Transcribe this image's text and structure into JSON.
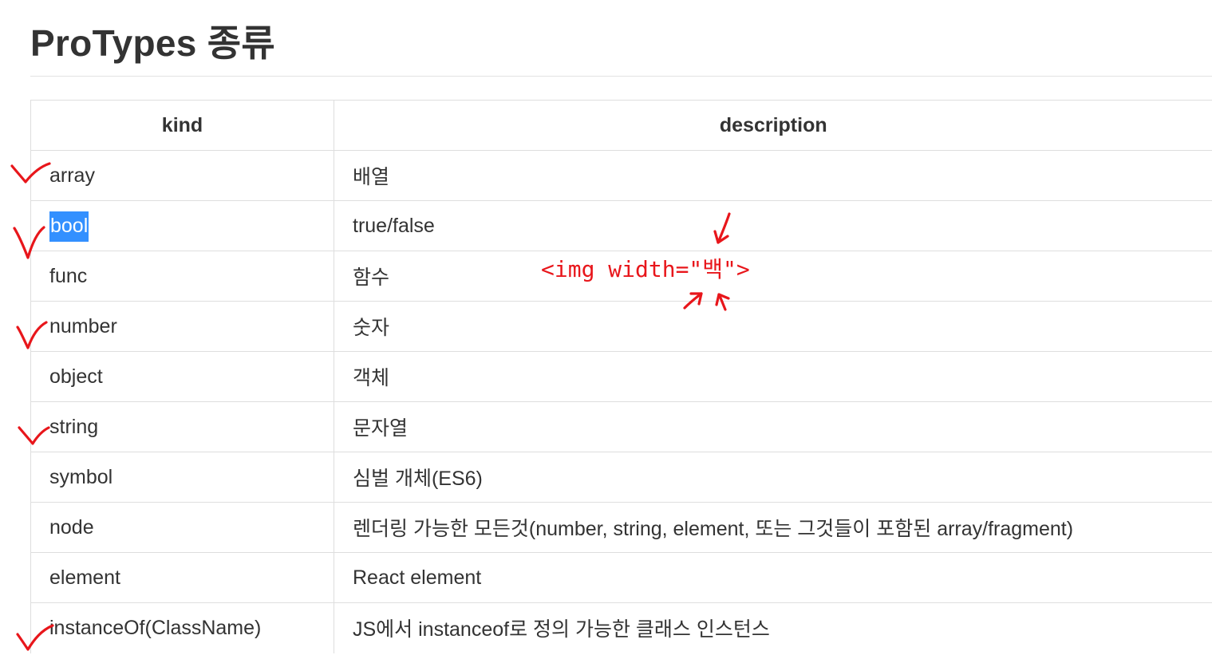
{
  "page": {
    "title": "ProTypes 종류"
  },
  "table": {
    "headers": {
      "kind": "kind",
      "description": "description"
    },
    "rows": [
      {
        "kind": "array",
        "description": "배열",
        "checked": true,
        "selected": false
      },
      {
        "kind": "bool",
        "description": "true/false",
        "checked": true,
        "selected": true
      },
      {
        "kind": "func",
        "description": "함수",
        "checked": false,
        "selected": false
      },
      {
        "kind": "number",
        "description": "숫자",
        "checked": true,
        "selected": false
      },
      {
        "kind": "object",
        "description": "객체",
        "checked": false,
        "selected": false
      },
      {
        "kind": "string",
        "description": "문자열",
        "checked": true,
        "selected": false
      },
      {
        "kind": "symbol",
        "description": "심벌 개체(ES6)",
        "checked": false,
        "selected": false
      },
      {
        "kind": "node",
        "description": "렌더링 가능한 모든것(number, string, element, 또는 그것들이 포함된 array/fragment)",
        "checked": false,
        "selected": false
      },
      {
        "kind": "element",
        "description": "React element",
        "checked": false,
        "selected": false
      },
      {
        "kind": "instanceOf(ClassName)",
        "description": "JS에서 instanceof로 정의 가능한 클래스 인스턴스",
        "checked": true,
        "selected": false
      }
    ]
  },
  "annotation": {
    "text": "<img width=\"백\">",
    "color": "#e8161b"
  },
  "colors": {
    "text": "#333333",
    "border": "#dedede",
    "selection": "#3390ff",
    "annotation": "#e8161b"
  },
  "icons": {
    "check_mark": "red-handwritten-check-icon",
    "arrow": "red-handwritten-arrow-icon"
  }
}
